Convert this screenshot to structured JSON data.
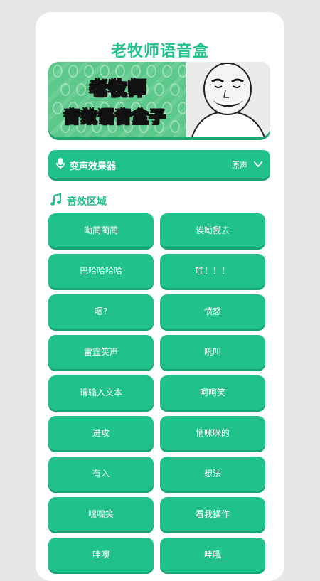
{
  "app": {
    "title": "老牧师语音盒"
  },
  "banner": {
    "line1": "老牧师",
    "line2": "音效语音盒子"
  },
  "voice_changer": {
    "label": "变声效果器",
    "value": "原声"
  },
  "section": {
    "title": "音效区域"
  },
  "colors": {
    "accent": "#21c289",
    "background": "#e6e8e7",
    "card": "#ffffff"
  },
  "icons": [
    "mic-icon",
    "chevron-down-icon",
    "music-note-icon",
    "meme-face-icon"
  ],
  "sounds": [
    "呦蔺蔺蔺",
    "诶呦我去",
    "巴哈哈哈哈",
    "哇！！！",
    "嗯?",
    "愤怒",
    "雷霆笑声",
    "吼叫",
    "请输入文本",
    "呵呵笑",
    "进攻",
    "悄咪咪的",
    "有入",
    "想法",
    "嘿嘿笑",
    "看我操作",
    "哇噢",
    "哇哦"
  ]
}
